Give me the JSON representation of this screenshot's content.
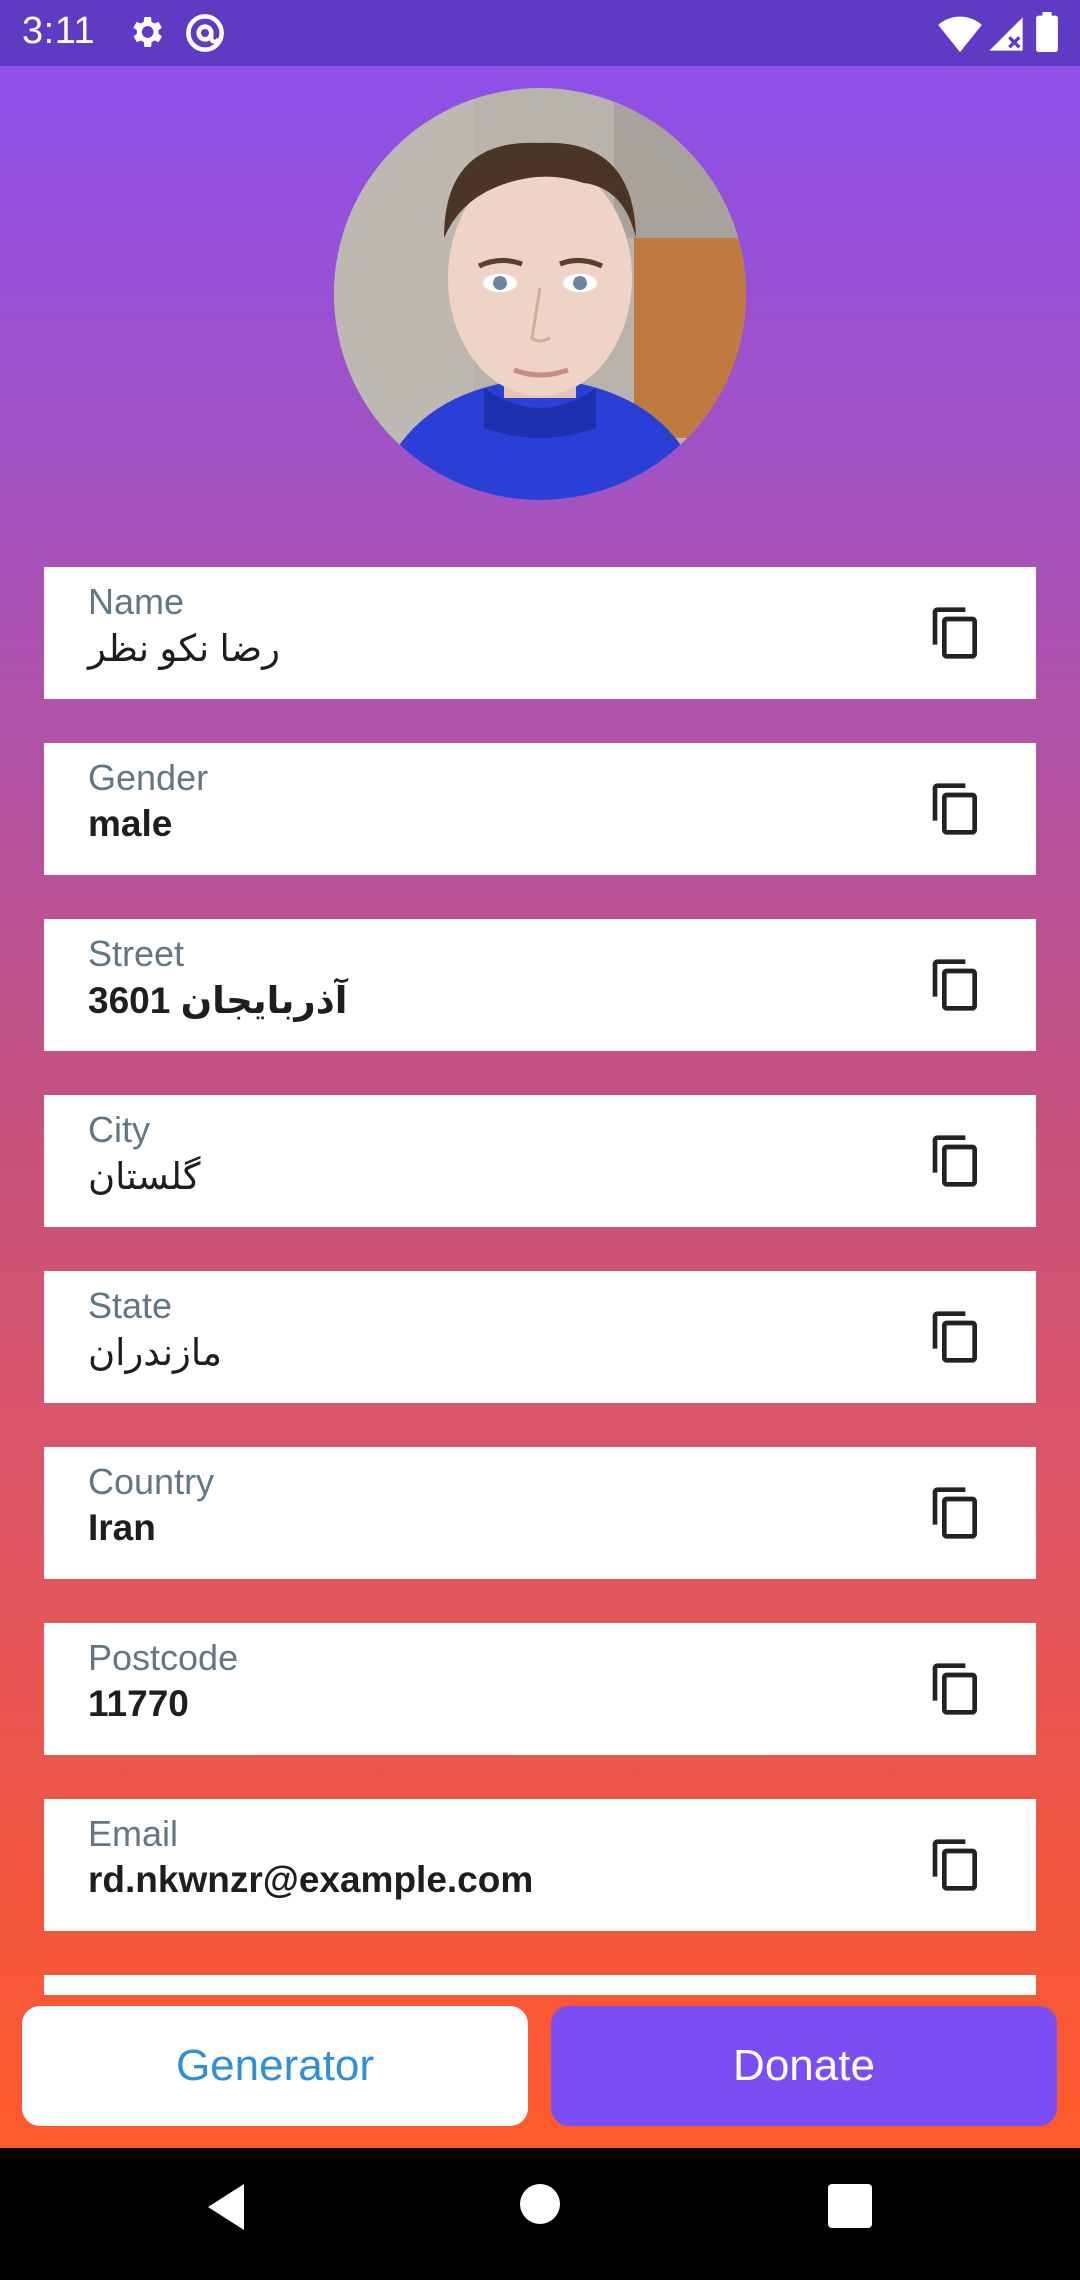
{
  "status_bar": {
    "time": "3:11",
    "icons": [
      "gear-icon",
      "at-sign-icon",
      "wifi-icon",
      "signal-icon",
      "battery-icon"
    ]
  },
  "profile": {
    "avatar_icon": "avatar-photo"
  },
  "fields": [
    {
      "label": "Name",
      "value": "رضا نكو نظر"
    },
    {
      "label": "Gender",
      "value": "male"
    },
    {
      "label": "Street",
      "value": "3601 آذربایجان"
    },
    {
      "label": "City",
      "value": "گلستان"
    },
    {
      "label": "State",
      "value": "مازندران"
    },
    {
      "label": "Country",
      "value": "Iran"
    },
    {
      "label": "Postcode",
      "value": "11770"
    },
    {
      "label": "Email",
      "value": "rd.nkwnzr@example.com"
    }
  ],
  "buttons": {
    "generator": "Generator",
    "donate": "Donate"
  },
  "colors": {
    "gradient_top": "#8a4ff0",
    "gradient_bottom": "#ff5a2c",
    "status_bar": "#5f3bc4",
    "donate_button": "#7b4ef5",
    "generator_text": "#2f8fdc",
    "label_text": "#627783"
  },
  "nav_bar": {
    "icons": [
      "back-icon",
      "home-icon",
      "recents-icon"
    ]
  }
}
